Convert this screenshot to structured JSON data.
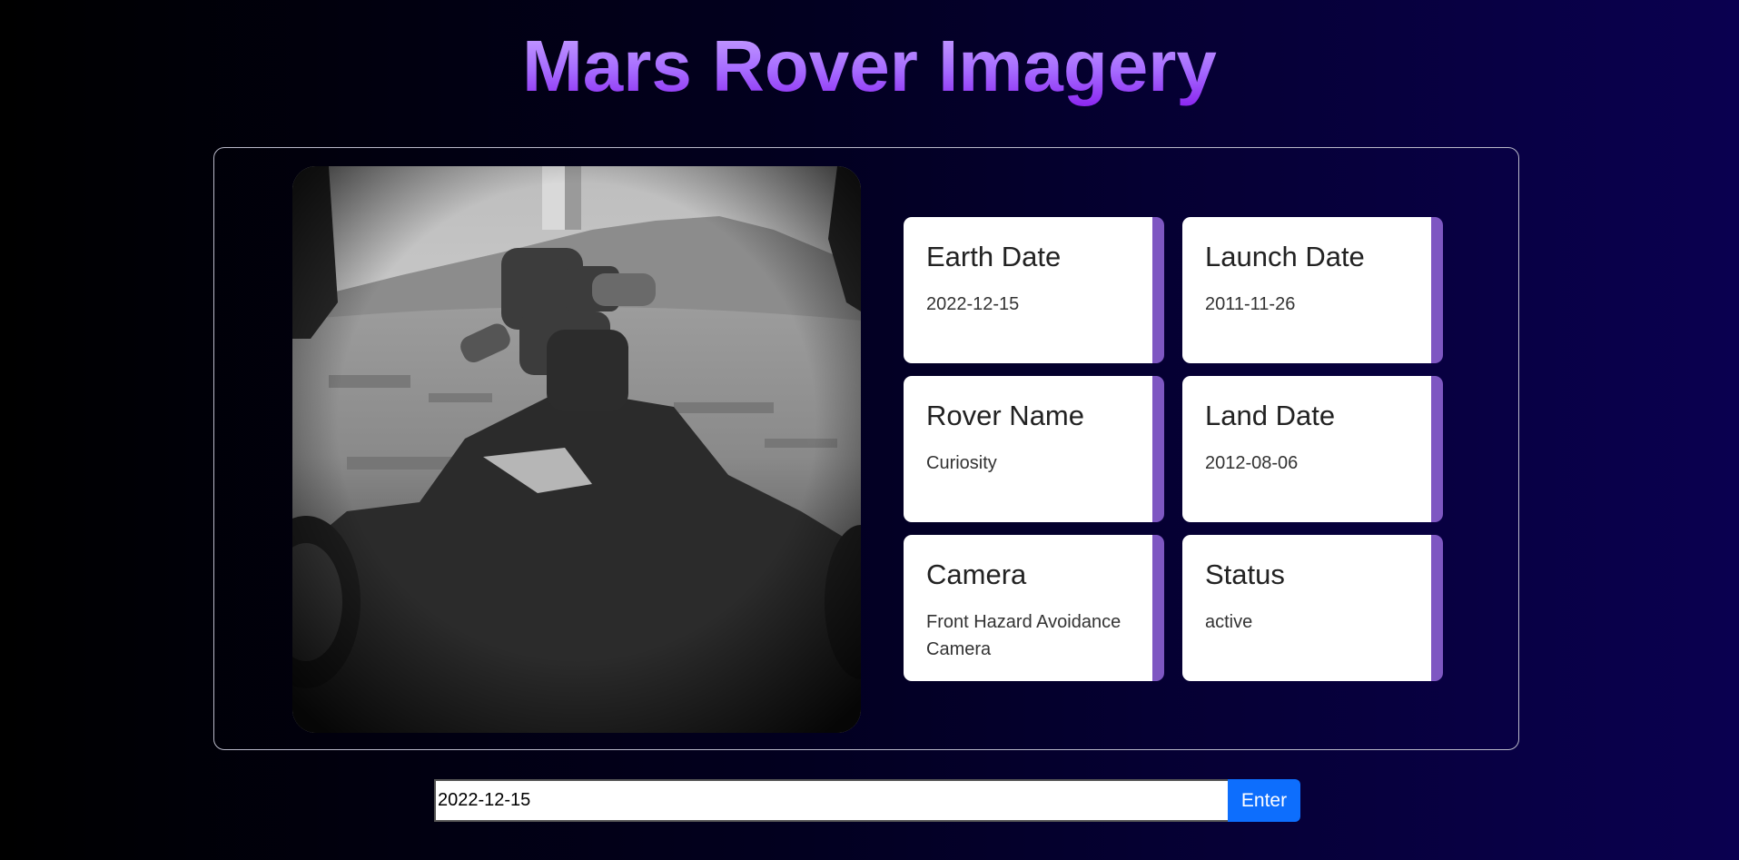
{
  "header": {
    "title": "Mars Rover Imagery"
  },
  "photo": {
    "alt": "Mars rover front hazard camera image"
  },
  "cards": [
    {
      "label": "Earth Date",
      "value": "2022-12-15"
    },
    {
      "label": "Launch Date",
      "value": "2011-11-26"
    },
    {
      "label": "Rover Name",
      "value": "Curiosity"
    },
    {
      "label": "Land Date",
      "value": "2012-08-06"
    },
    {
      "label": "Camera",
      "value": "Front Hazard Avoidance Camera"
    },
    {
      "label": "Status",
      "value": "active"
    }
  ],
  "search": {
    "value": "2022-12-15",
    "button_label": "Enter"
  },
  "colors": {
    "title_gradient_top": "#c9a6ff",
    "title_gradient_bottom": "#8b25f0",
    "card_accent": "#7e57c2",
    "button": "#0d6efd"
  }
}
